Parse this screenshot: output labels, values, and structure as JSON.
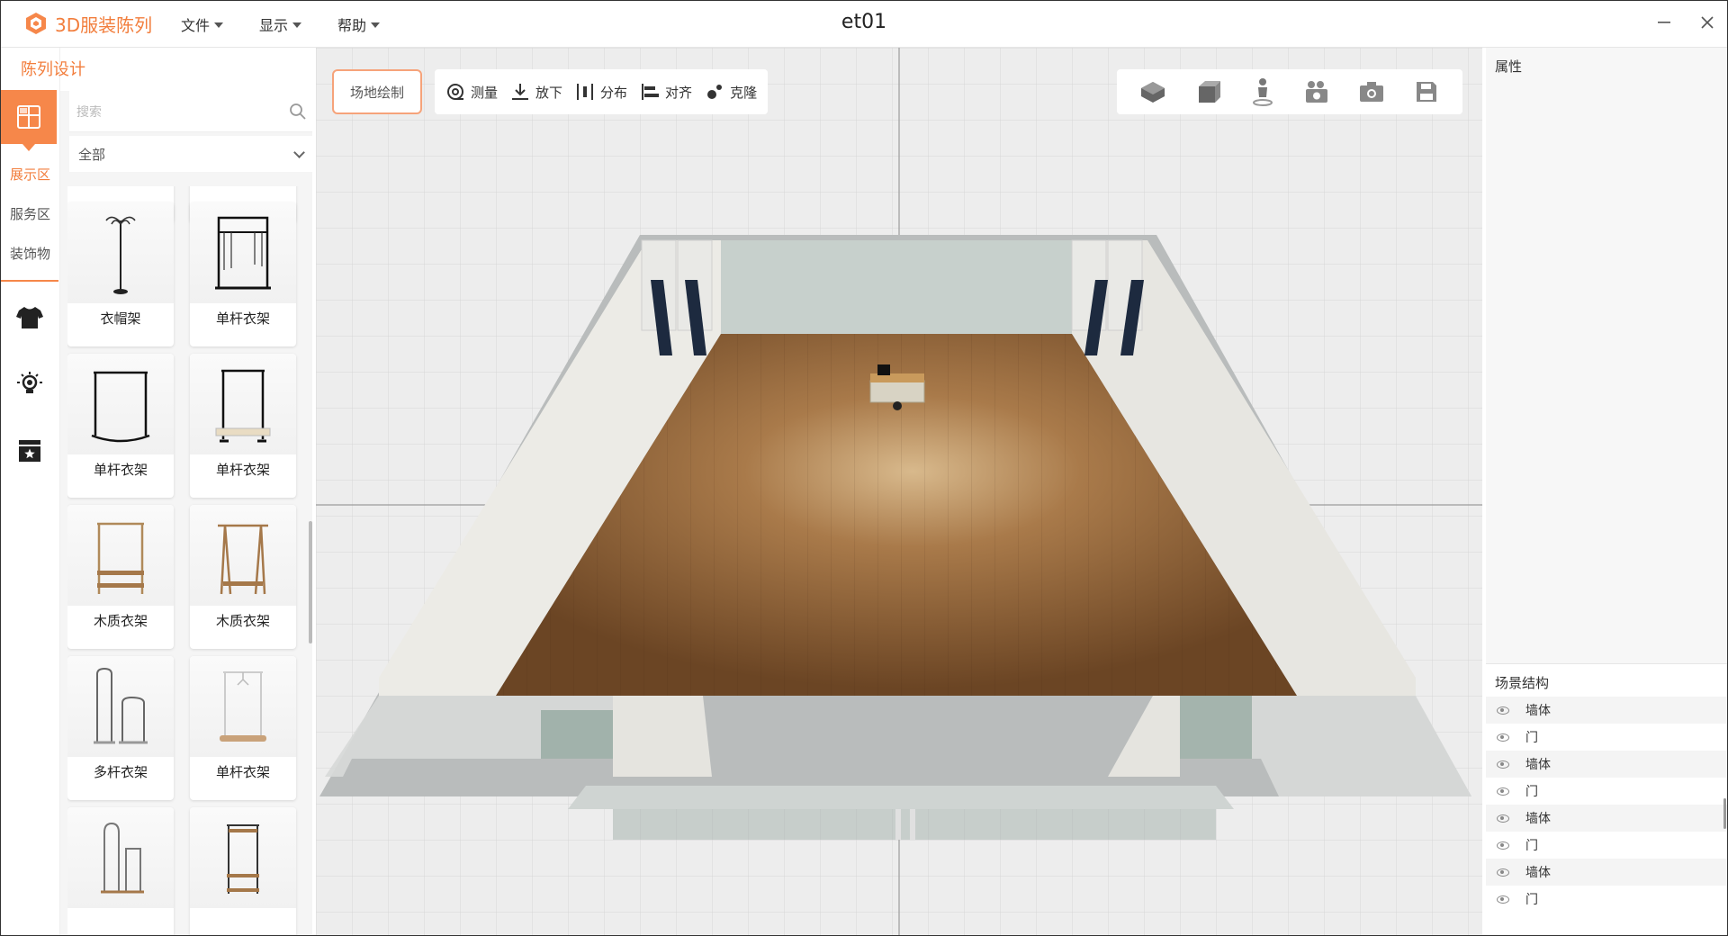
{
  "app": {
    "name": "3D服装陈列",
    "document_title": "et01",
    "accent_color": "#f27e3d",
    "menus": [
      {
        "label": "文件"
      },
      {
        "label": "显示"
      },
      {
        "label": "帮助"
      }
    ],
    "window_controls": [
      "minimize-icon",
      "close-icon"
    ]
  },
  "left_panel": {
    "title": "陈列设计",
    "tabs": [
      {
        "label": "展示区",
        "active": true
      },
      {
        "label": "服务区",
        "active": false
      },
      {
        "label": "装饰物",
        "active": false
      }
    ],
    "category_icons": [
      "layout-icon",
      "tshirt-icon",
      "lightbulb-icon",
      "showcase-icon"
    ]
  },
  "catalog": {
    "search_placeholder": "搜索",
    "search_value": "",
    "filter_value": "全部",
    "items": [
      {
        "label": "衣帽架",
        "icon": "coat-stand-icon"
      },
      {
        "label": "单杆衣架",
        "icon": "single-rack-icon"
      },
      {
        "label": "单杆衣架",
        "icon": "arched-rack-icon"
      },
      {
        "label": "单杆衣架",
        "icon": "rack-with-shelf-icon"
      },
      {
        "label": "木质衣架",
        "icon": "wooden-rack-icon"
      },
      {
        "label": "木质衣架",
        "icon": "wooden-a-rack-icon"
      },
      {
        "label": "多杆衣架",
        "icon": "multi-rack-icon"
      },
      {
        "label": "单杆衣架",
        "icon": "single-rack-base-icon"
      },
      {
        "label": "",
        "icon": "tall-rack-icon"
      },
      {
        "label": "",
        "icon": "shelf-rack-icon"
      }
    ]
  },
  "viewport": {
    "site_button": "场地绘制",
    "tools": [
      {
        "label": "测量",
        "icon": "measure-icon"
      },
      {
        "label": "放下",
        "icon": "drop-icon"
      },
      {
        "label": "分布",
        "icon": "distribute-icon"
      },
      {
        "label": "对齐",
        "icon": "align-icon"
      },
      {
        "label": "克隆",
        "icon": "clone-icon"
      }
    ],
    "view_icons": [
      "perspective-view-icon",
      "top-view-icon",
      "walk-view-icon",
      "video-icon",
      "screenshot-icon",
      "save-icon"
    ]
  },
  "right_panel": {
    "properties_title": "属性",
    "scene_title": "场景结构",
    "scene_items": [
      {
        "label": "墙体"
      },
      {
        "label": "门"
      },
      {
        "label": "墙体"
      },
      {
        "label": "门"
      },
      {
        "label": "墙体"
      },
      {
        "label": "门"
      },
      {
        "label": "墙体"
      },
      {
        "label": "门"
      }
    ]
  }
}
